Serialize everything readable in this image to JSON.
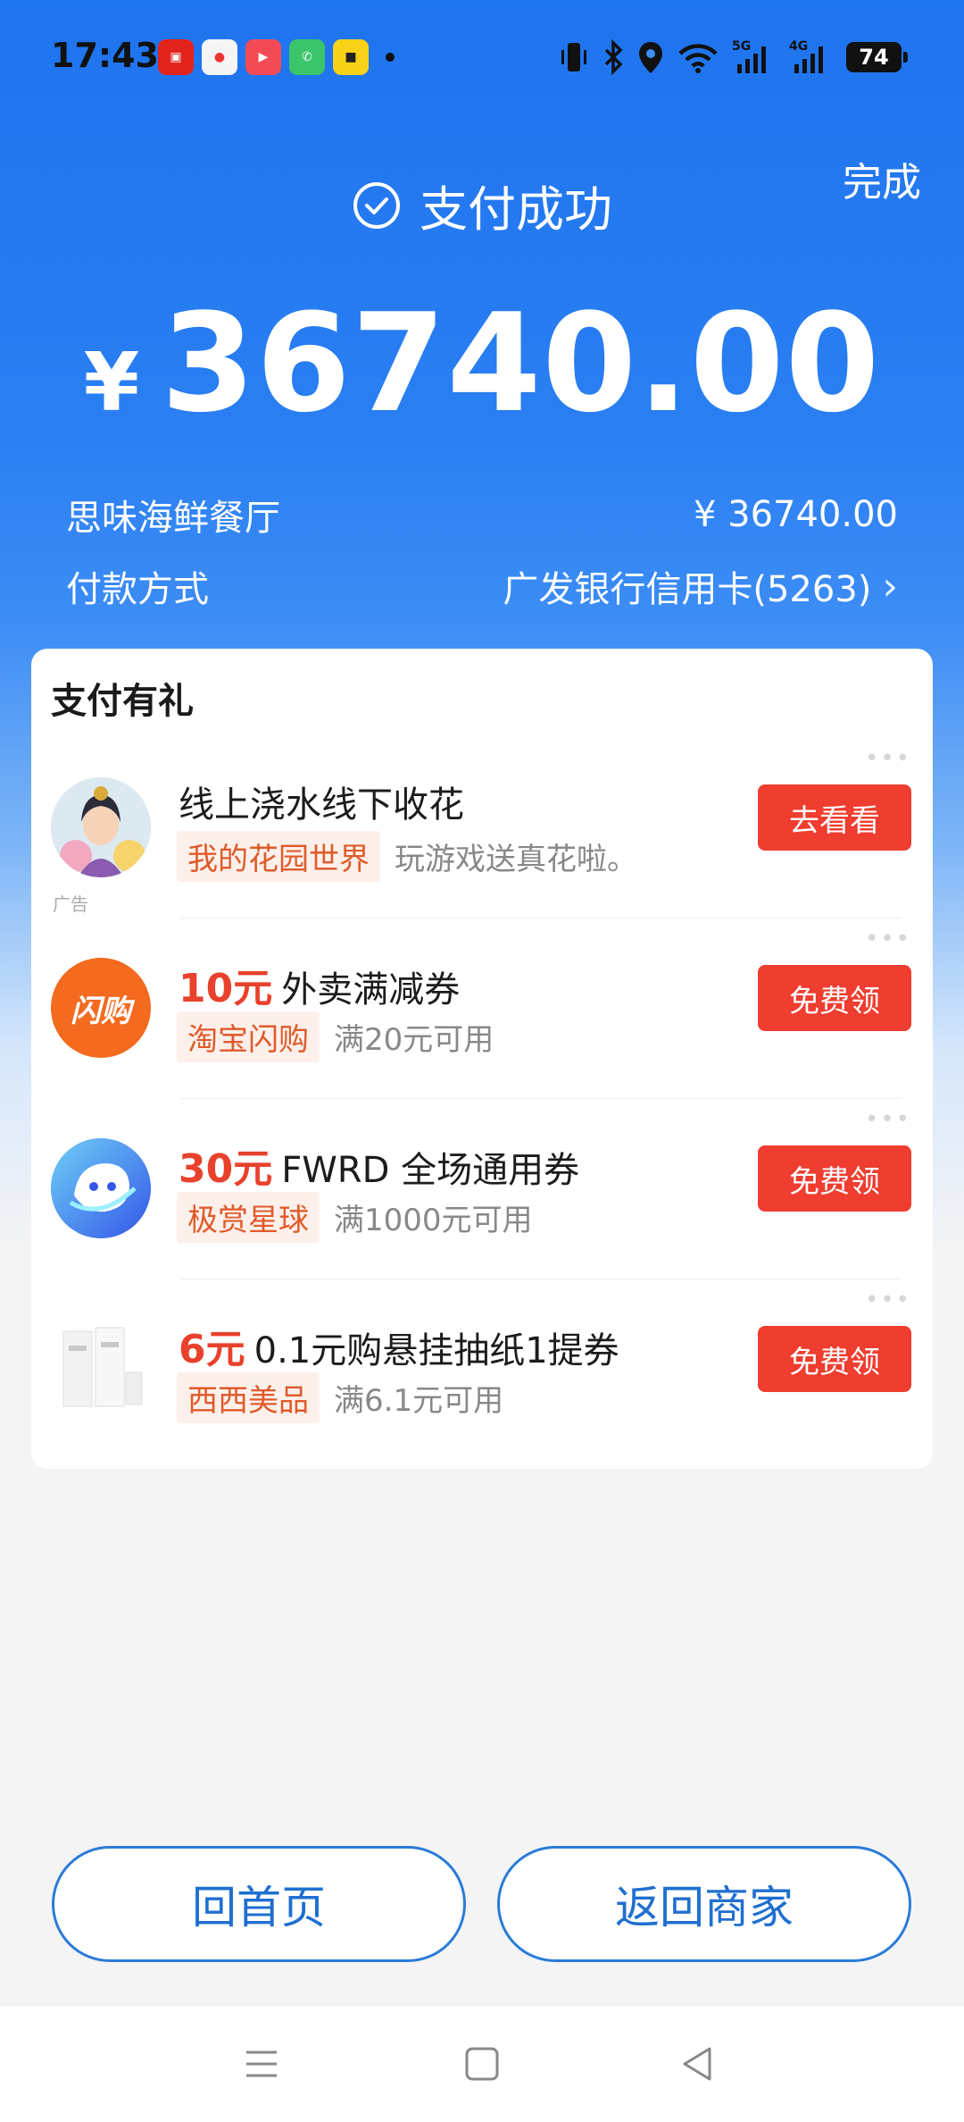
{
  "status_bar": {
    "time": "17:43",
    "battery": "74",
    "signal_5g": "5G",
    "signal_4g": "4G"
  },
  "header": {
    "done_label": "完成",
    "status_title": "支付成功",
    "currency_symbol": "¥",
    "amount": "36740.00"
  },
  "details": {
    "merchant_name": "思味海鲜餐厅",
    "merchant_amount": "¥ 36740.00",
    "payment_method_label": "付款方式",
    "payment_method_value": "广发银行信用卡(5263)"
  },
  "rewards": {
    "title": "支付有礼",
    "ad_label": "广告",
    "offers": [
      {
        "price": "",
        "title": "线上浇水线下收花",
        "tag": "我的花园世界",
        "desc": "玩游戏送真花啦。",
        "button": "去看看",
        "logo": "garden-game-avatar"
      },
      {
        "price": "10元",
        "title": "外卖满减券",
        "tag": "淘宝闪购",
        "desc": "满20元可用",
        "button": "免费领",
        "logo": "taobao-flash-logo",
        "logo_text": "闪购"
      },
      {
        "price": "30元",
        "title": "FWRD 全场通用券",
        "tag": "极赏星球",
        "desc": "满1000元可用",
        "button": "免费领",
        "logo": "planet-logo"
      },
      {
        "price": "6元",
        "title": "0.1元购悬挂抽纸1提券",
        "tag": "西西美品",
        "desc": "满6.1元可用",
        "button": "免费领",
        "logo": "tissue-product-image"
      }
    ]
  },
  "bottom_buttons": {
    "home_label": "回首页",
    "back_merchant_label": "返回商家"
  },
  "colors": {
    "header_blue": "#1f74ef",
    "accent_red": "#ef3d2f",
    "button_blue": "#1f6fd0"
  }
}
